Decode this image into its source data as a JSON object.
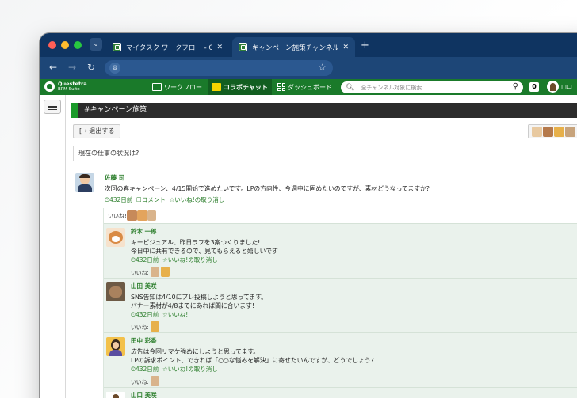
{
  "browser": {
    "tabs": [
      {
        "title": "マイタスク ワークフロー - Ques",
        "active": false
      },
      {
        "title": "キャンペーン施策チャンネル コ",
        "active": true
      }
    ]
  },
  "app": {
    "logo_line1": "Questetra",
    "logo_line2": "BPM Suite",
    "nav": [
      {
        "label": "ワークフロー",
        "icon": "workflow-icon"
      },
      {
        "label": "コラボチャット",
        "icon": "chat-icon"
      },
      {
        "label": "ダッシュボード",
        "icon": "dashboard-icon"
      }
    ],
    "search_placeholder": "全チャンネル対象に検索",
    "notification_count": "0",
    "user_name": "山口"
  },
  "channel": {
    "title": "#キャンペーン施策",
    "leave_label": "退出する",
    "topic": "現在の仕事の状況は?"
  },
  "post": {
    "author": "佐藤 司",
    "text": "次回の春キャンペーン、4/15開始で進めたいです。LPの方向性、今週中に固めたいのですが、素材どうなってますか?",
    "time": "432日前",
    "comment_label": "コメント",
    "unlike_label": "いいね!の取り消し",
    "likes_label": "いいね!"
  },
  "replies": [
    {
      "author": "鈴木 一郎",
      "lines": [
        "キービジュアル、昨日ラフを3案つくりました!",
        "今日中に共有できるので、見てもらえると嬉しいです"
      ],
      "time": "432日前",
      "action": "いいね!の取り消し",
      "likes_label": "いいね:"
    },
    {
      "author": "山田 美咲",
      "lines": [
        "SNS告知は4/10にプレ投稿しようと思ってます。",
        "バナー素材が4/8までにあれば間に合います!"
      ],
      "time": "432日前",
      "action": "いいね!",
      "likes_label": "いいね:"
    },
    {
      "author": "田中 彩香",
      "lines": [
        "広告は今回リマケ強めにしようと思ってます。",
        "LPの訴求ポイント、できれば「○○な悩みを解決」に寄せたいんですが、どうでしょう?"
      ],
      "time": "432日前",
      "action": "いいね!の取り消し",
      "likes_label": "いいね:"
    },
    {
      "author": "山口 美咲",
      "lines": [],
      "time": "",
      "action": "",
      "likes_label": ""
    }
  ],
  "colors": {
    "tabstrip": "#0f3461",
    "appbar": "#1a7a2a",
    "accent_green": "#2a7d2a",
    "thread_bg": "#eaf2ec"
  }
}
